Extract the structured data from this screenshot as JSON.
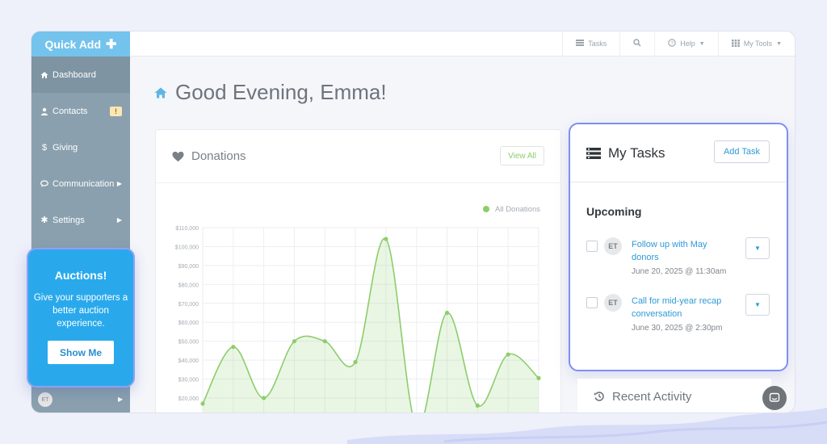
{
  "sidebar": {
    "quick_add": "Quick Add",
    "items": [
      {
        "label": "Dashboard",
        "icon": "home-icon"
      },
      {
        "label": "Contacts",
        "icon": "user-icon",
        "badge": "!"
      },
      {
        "label": "Giving",
        "icon": "dollar-icon"
      },
      {
        "label": "Communication",
        "icon": "chat-icon"
      },
      {
        "label": "Settings",
        "icon": "gear-icon"
      }
    ],
    "user_initials": "ET"
  },
  "topbar": {
    "tasks": "Tasks",
    "help": "Help",
    "my_tools": "My Tools"
  },
  "greeting": "Good Evening, Emma!",
  "donations": {
    "title": "Donations",
    "view_all": "View All"
  },
  "chart_data": {
    "type": "line",
    "legend": "All Donations",
    "legend_position": "top-right",
    "y_ticks": [
      "$110,000",
      "$100,000",
      "$90,000",
      "$80,000",
      "$70,000",
      "$60,000",
      "$50,000",
      "$40,000",
      "$30,000",
      "$20,000"
    ],
    "ylim": [
      20000,
      110000
    ],
    "values": [
      17000,
      47000,
      20000,
      50000,
      50000,
      39000,
      104000,
      5000,
      65000,
      16000,
      43000,
      30500
    ],
    "grid": true,
    "color": "#8ccd6b"
  },
  "tasks": {
    "title": "My Tasks",
    "add_label": "Add Task",
    "section": "Upcoming",
    "items": [
      {
        "initials": "ET",
        "title": "Follow up with May donors",
        "date": "June 20, 2025 @ 11:30am"
      },
      {
        "initials": "ET",
        "title": "Call for mid-year recap conversation",
        "date": "June 30, 2025 @ 2:30pm"
      }
    ]
  },
  "recent": {
    "title": "Recent Activity"
  },
  "auctions": {
    "title": "Auctions!",
    "body": "Give your supporters a better auction experience.",
    "button": "Show Me"
  },
  "colors": {
    "accent": "#29a9ec",
    "sidebar": "#8aa0ae",
    "chart": "#8ccd6b",
    "highlight": "#7f8ef4"
  }
}
